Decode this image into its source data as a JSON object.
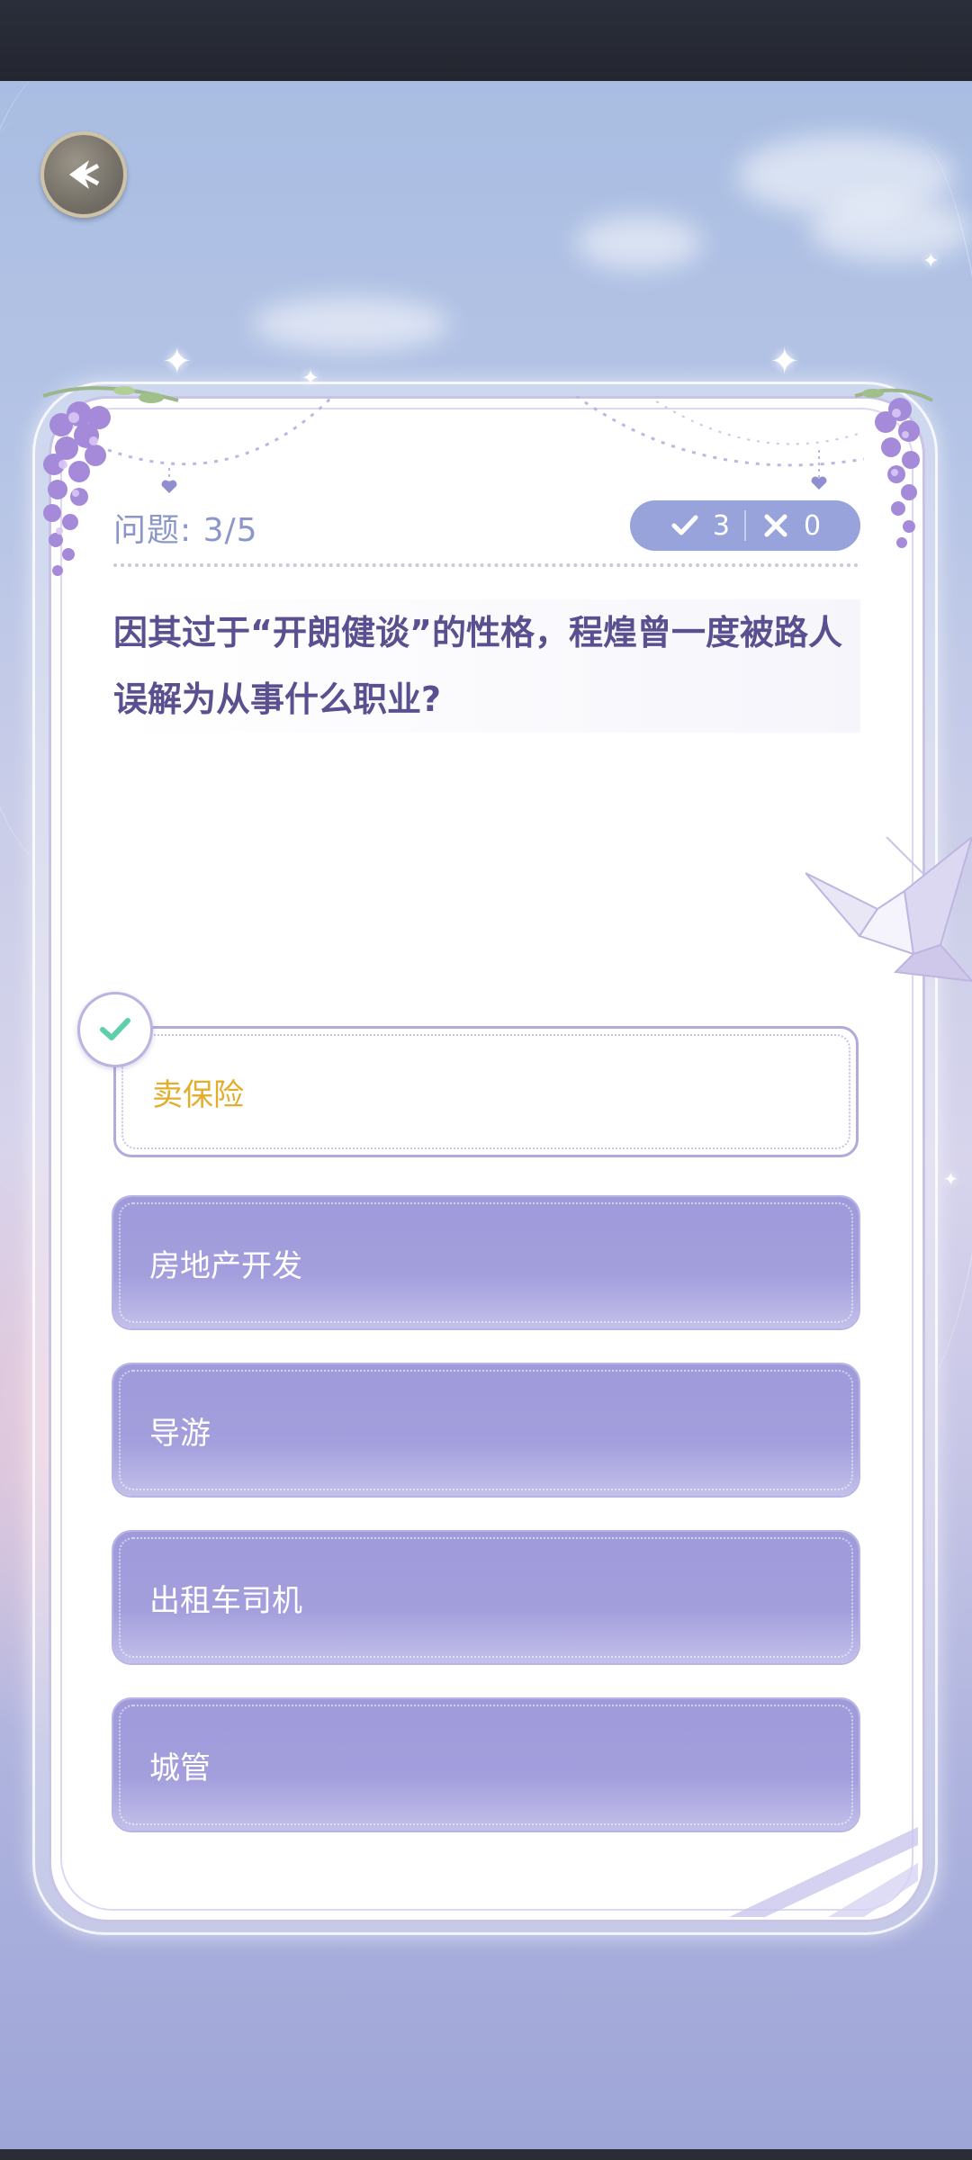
{
  "quiz": {
    "progress_label": "问题: 3/5",
    "correct_count": "3",
    "wrong_count": "0",
    "question": "因其过于“开朗健谈”的性格，程煌曾一度被路人误解为从事什么职业?",
    "selected_index": 0,
    "options": [
      {
        "label": "卖保险",
        "selected": true,
        "correct": true
      },
      {
        "label": "房地产开发",
        "selected": false
      },
      {
        "label": "导游",
        "selected": false
      },
      {
        "label": "出租车司机",
        "selected": false
      },
      {
        "label": "城管",
        "selected": false
      }
    ]
  },
  "icons": {
    "back": "back-arrow-icon",
    "correct": "check-icon",
    "wrong": "cross-icon",
    "selected": "check-badge-icon"
  },
  "colors": {
    "option_bg": "#a39fdd",
    "selected_text": "#e2ae2c",
    "question_text": "#5a4f8f",
    "score_pill": "#97a3da",
    "check_green": "#5fcfa7"
  }
}
